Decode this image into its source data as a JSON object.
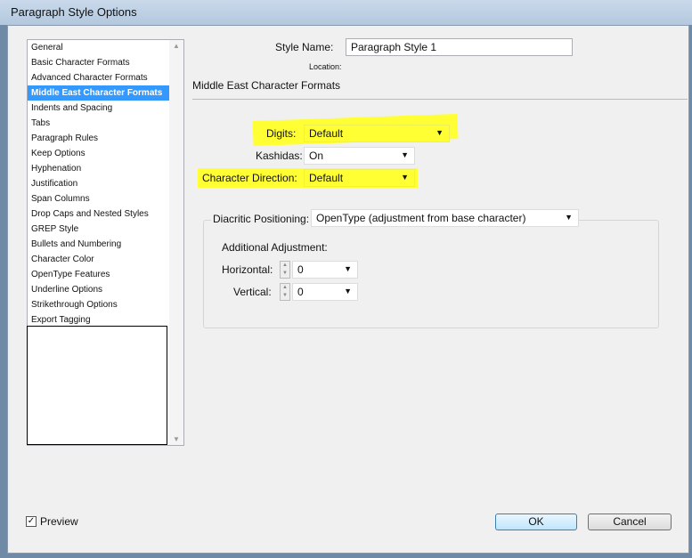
{
  "window": {
    "title": "Paragraph Style Options"
  },
  "sidebar": {
    "items": [
      "General",
      "Basic Character Formats",
      "Advanced Character Formats",
      "Middle East Character Formats",
      "Indents and Spacing",
      "Tabs",
      "Paragraph Rules",
      "Keep Options",
      "Hyphenation",
      "Justification",
      "Span Columns",
      "Drop Caps and Nested Styles",
      "GREP Style",
      "Bullets and Numbering",
      "Character Color",
      "OpenType Features",
      "Underline Options",
      "Strikethrough Options",
      "Export Tagging"
    ],
    "selected_index": 3
  },
  "header": {
    "style_name_label": "Style Name:",
    "style_name_value": "Paragraph Style 1",
    "location_label": "Location:",
    "section_title": "Middle East Character Formats"
  },
  "fields": {
    "digits_label": "Digits:",
    "digits_value": "Default",
    "kashidas_label": "Kashidas:",
    "kashidas_value": "On",
    "direction_label": "Character Direction:",
    "direction_value": "Default"
  },
  "diacritic": {
    "label": "Diacritic Positioning:",
    "value": "OpenType (adjustment from base character)",
    "additional_label": "Additional Adjustment:",
    "horizontal_label": "Horizontal:",
    "horizontal_value": "0",
    "vertical_label": "Vertical:",
    "vertical_value": "0"
  },
  "footer": {
    "preview_label": "Preview",
    "preview_checked": true,
    "ok_label": "OK",
    "cancel_label": "Cancel"
  }
}
